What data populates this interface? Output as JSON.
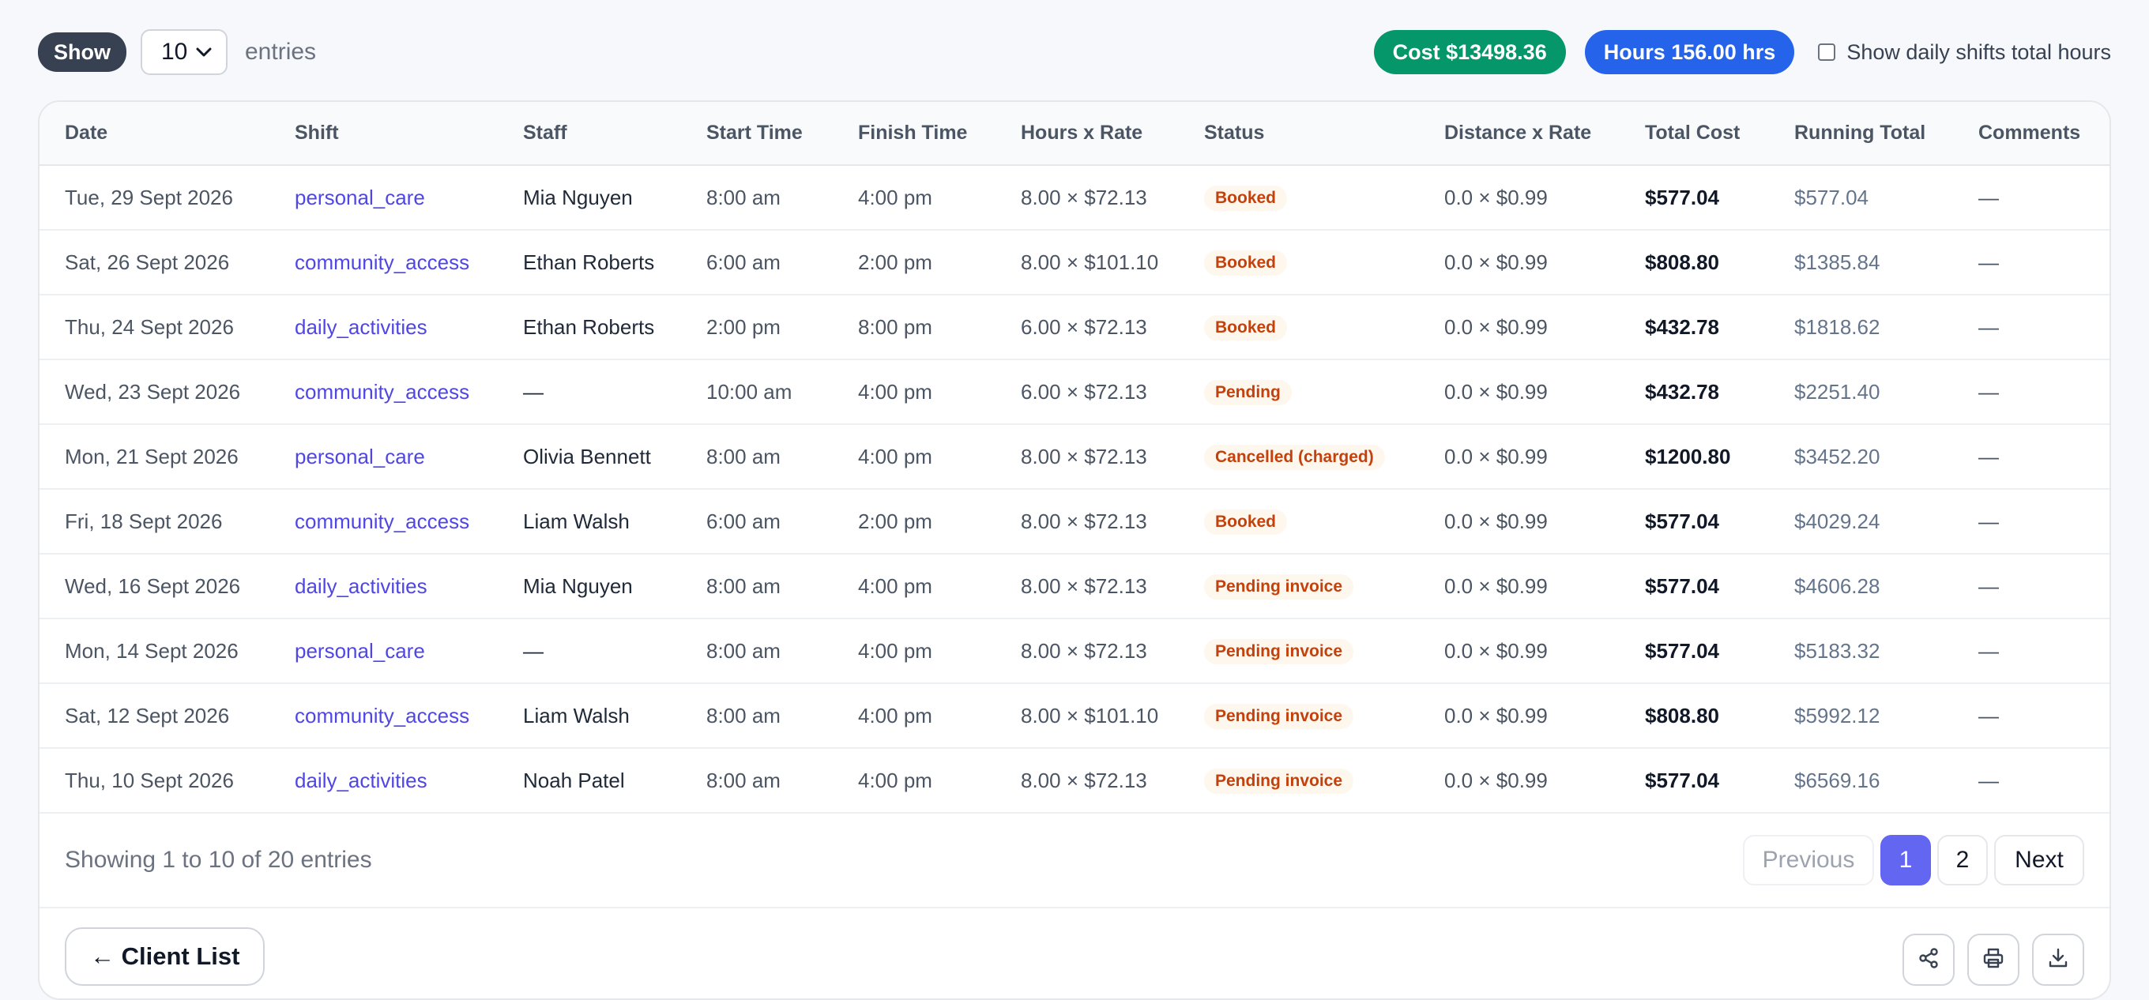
{
  "controls": {
    "show_label": "Show",
    "page_size": "10",
    "entries_label": "entries",
    "cost_pill": "Cost $13498.36",
    "hours_pill": "Hours 156.00 hrs",
    "daily_toggle_label": "Show daily shifts total hours"
  },
  "table": {
    "columns": [
      "Date",
      "Shift",
      "Staff",
      "Start Time",
      "Finish Time",
      "Hours x Rate",
      "Status",
      "Distance x Rate",
      "Total Cost",
      "Running Total",
      "Comments"
    ],
    "rows": [
      {
        "date": "Tue, 29 Sept 2026",
        "shift": "personal_care",
        "staff": "Mia Nguyen",
        "start": "8:00 am",
        "finish": "4:00 pm",
        "hours_rate": "8.00 × $72.13",
        "status": "Booked",
        "distance_rate": "0.0 × $0.99",
        "total": "$577.04",
        "running": "$577.04",
        "comments": "—"
      },
      {
        "date": "Sat, 26 Sept 2026",
        "shift": "community_access",
        "staff": "Ethan Roberts",
        "start": "6:00 am",
        "finish": "2:00 pm",
        "hours_rate": "8.00 × $101.10",
        "status": "Booked",
        "distance_rate": "0.0 × $0.99",
        "total": "$808.80",
        "running": "$1385.84",
        "comments": "—"
      },
      {
        "date": "Thu, 24 Sept 2026",
        "shift": "daily_activities",
        "staff": "Ethan Roberts",
        "start": "2:00 pm",
        "finish": "8:00 pm",
        "hours_rate": "6.00 × $72.13",
        "status": "Booked",
        "distance_rate": "0.0 × $0.99",
        "total": "$432.78",
        "running": "$1818.62",
        "comments": "—"
      },
      {
        "date": "Wed, 23 Sept 2026",
        "shift": "community_access",
        "staff": "—",
        "start": "10:00 am",
        "finish": "4:00 pm",
        "hours_rate": "6.00 × $72.13",
        "status": "Pending",
        "distance_rate": "0.0 × $0.99",
        "total": "$432.78",
        "running": "$2251.40",
        "comments": "—"
      },
      {
        "date": "Mon, 21 Sept 2026",
        "shift": "personal_care",
        "staff": "Olivia Bennett",
        "start": "8:00 am",
        "finish": "4:00 pm",
        "hours_rate": "8.00 × $72.13",
        "status": "Cancelled (charged)",
        "distance_rate": "0.0 × $0.99",
        "total": "$1200.80",
        "running": "$3452.20",
        "comments": "—"
      },
      {
        "date": "Fri, 18 Sept 2026",
        "shift": "community_access",
        "staff": "Liam Walsh",
        "start": "6:00 am",
        "finish": "2:00 pm",
        "hours_rate": "8.00 × $72.13",
        "status": "Booked",
        "distance_rate": "0.0 × $0.99",
        "total": "$577.04",
        "running": "$4029.24",
        "comments": "—"
      },
      {
        "date": "Wed, 16 Sept 2026",
        "shift": "daily_activities",
        "staff": "Mia Nguyen",
        "start": "8:00 am",
        "finish": "4:00 pm",
        "hours_rate": "8.00 × $72.13",
        "status": "Pending invoice",
        "distance_rate": "0.0 × $0.99",
        "total": "$577.04",
        "running": "$4606.28",
        "comments": "—"
      },
      {
        "date": "Mon, 14 Sept 2026",
        "shift": "personal_care",
        "staff": "—",
        "start": "8:00 am",
        "finish": "4:00 pm",
        "hours_rate": "8.00 × $72.13",
        "status": "Pending invoice",
        "distance_rate": "0.0 × $0.99",
        "total": "$577.04",
        "running": "$5183.32",
        "comments": "—"
      },
      {
        "date": "Sat, 12 Sept 2026",
        "shift": "community_access",
        "staff": "Liam Walsh",
        "start": "8:00 am",
        "finish": "4:00 pm",
        "hours_rate": "8.00 × $101.10",
        "status": "Pending invoice",
        "distance_rate": "0.0 × $0.99",
        "total": "$808.80",
        "running": "$5992.12",
        "comments": "—"
      },
      {
        "date": "Thu, 10 Sept 2026",
        "shift": "daily_activities",
        "staff": "Noah Patel",
        "start": "8:00 am",
        "finish": "4:00 pm",
        "hours_rate": "8.00 × $72.13",
        "status": "Pending invoice",
        "distance_rate": "0.0 × $0.99",
        "total": "$577.04",
        "running": "$6569.16",
        "comments": "—"
      }
    ]
  },
  "footer": {
    "showing": "Showing 1 to 10 of 20 entries",
    "previous": "Previous",
    "pages": [
      "1",
      "2"
    ],
    "next": "Next"
  },
  "bottom": {
    "back_label": "← Client List",
    "icons": [
      "share-icon",
      "print-icon",
      "download-icon"
    ]
  }
}
